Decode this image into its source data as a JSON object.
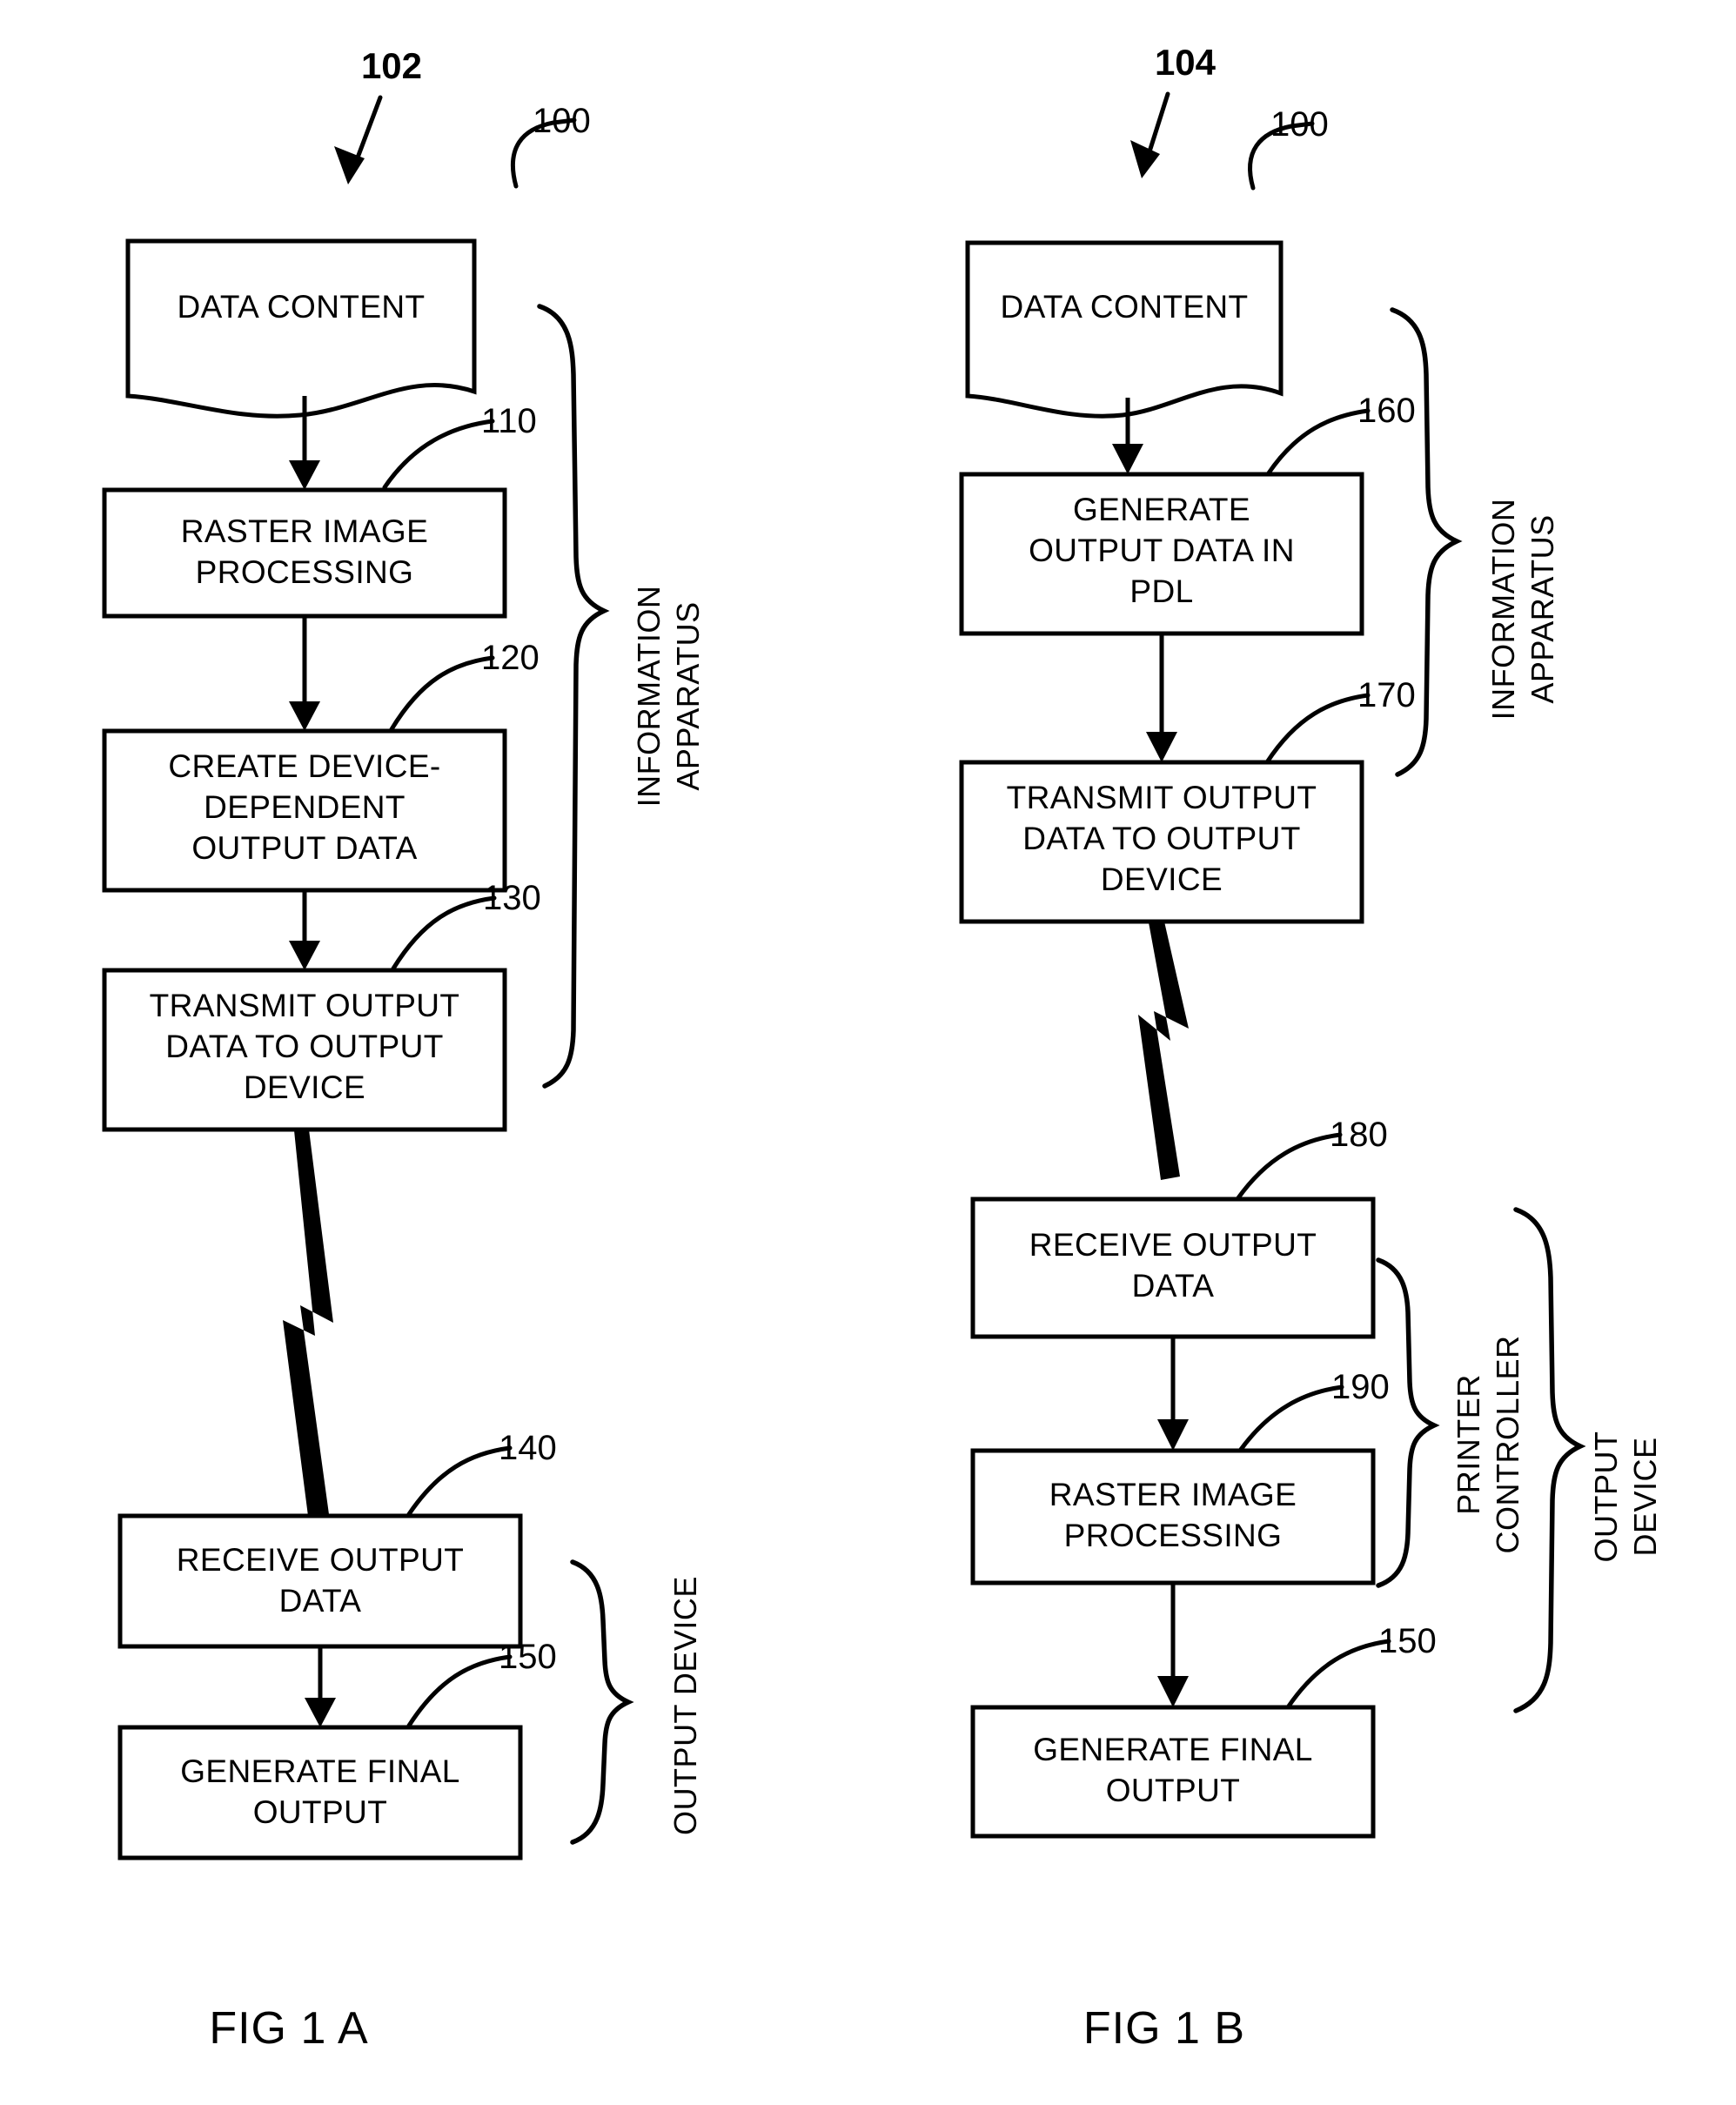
{
  "figure": {
    "page_title": "Patent Drawing - Output Data Flow",
    "captions": {
      "fig_a": "FIG 1 A",
      "fig_b": "FIG 1 B"
    }
  },
  "fig_a": {
    "diagram_ref": "102",
    "boxes": [
      {
        "id": "data-content",
        "ref": "100",
        "lines": [
          "DATA CONTENT"
        ],
        "shape": "document"
      },
      {
        "id": "raster-image",
        "ref": "110",
        "lines": [
          "RASTER IMAGE",
          "PROCESSING"
        ],
        "shape": "rect"
      },
      {
        "id": "create-device",
        "ref": "120",
        "lines": [
          "CREATE DEVICE-",
          "DEPENDENT",
          "OUTPUT DATA"
        ],
        "shape": "rect"
      },
      {
        "id": "transmit",
        "ref": "130",
        "lines": [
          "TRANSMIT OUTPUT",
          "DATA TO OUTPUT",
          "DEVICE"
        ],
        "shape": "rect"
      },
      {
        "id": "receive",
        "ref": "140",
        "lines": [
          "RECEIVE OUTPUT",
          "DATA"
        ],
        "shape": "rect"
      },
      {
        "id": "generate-final",
        "ref": "150",
        "lines": [
          "GENERATE FINAL",
          "OUTPUT"
        ],
        "shape": "rect"
      }
    ],
    "groups": [
      {
        "id": "information-apparatus",
        "lines": [
          "INFORMATION",
          "APPARATUS"
        ]
      },
      {
        "id": "output-device",
        "lines": [
          "OUTPUT DEVICE"
        ]
      }
    ]
  },
  "fig_b": {
    "diagram_ref": "104",
    "boxes": [
      {
        "id": "data-content",
        "ref": "100",
        "lines": [
          "DATA CONTENT"
        ],
        "shape": "document"
      },
      {
        "id": "generate-pdl",
        "ref": "160",
        "lines": [
          "GENERATE",
          "OUTPUT DATA IN",
          "PDL"
        ],
        "shape": "rect"
      },
      {
        "id": "transmit",
        "ref": "170",
        "lines": [
          "TRANSMIT OUTPUT",
          "DATA TO OUTPUT",
          "DEVICE"
        ],
        "shape": "rect"
      },
      {
        "id": "receive",
        "ref": "180",
        "lines": [
          "RECEIVE OUTPUT",
          "DATA"
        ],
        "shape": "rect"
      },
      {
        "id": "raster-image",
        "ref": "190",
        "lines": [
          "RASTER IMAGE",
          "PROCESSING"
        ],
        "shape": "rect"
      },
      {
        "id": "generate-final",
        "ref": "150",
        "lines": [
          "GENERATE FINAL",
          "OUTPUT"
        ],
        "shape": "rect"
      }
    ],
    "groups": [
      {
        "id": "information-apparatus",
        "lines": [
          "INFORMATION",
          "APPARATUS"
        ]
      },
      {
        "id": "printer-controller",
        "lines": [
          "PRINTER",
          "CONTROLLER"
        ]
      },
      {
        "id": "output-device",
        "lines": [
          "OUTPUT",
          "DEVICE"
        ]
      }
    ]
  },
  "text": {
    "a_100": "100",
    "a_102": "102",
    "a_110": "110",
    "a_120": "120",
    "a_130": "130",
    "a_140": "140",
    "a_150": "150",
    "b_100": "100",
    "b_104": "104",
    "b_150": "150",
    "b_160": "160",
    "b_170": "170",
    "b_180": "180",
    "b_190": "190",
    "a_data_content": "DATA CONTENT",
    "a_raster_1": "RASTER IMAGE",
    "a_raster_2": "PROCESSING",
    "a_create_1": "CREATE DEVICE-",
    "a_create_2": "DEPENDENT",
    "a_create_3": "OUTPUT DATA",
    "a_transmit_1": "TRANSMIT OUTPUT",
    "a_transmit_2": "DATA TO OUTPUT",
    "a_transmit_3": "DEVICE",
    "a_receive_1": "RECEIVE OUTPUT",
    "a_receive_2": "DATA",
    "a_final_1": "GENERATE FINAL",
    "a_final_2": "OUTPUT",
    "a_grp_info_1": "INFORMATION",
    "a_grp_info_2": "APPARATUS",
    "a_grp_outdev": "OUTPUT DEVICE",
    "b_data_content": "DATA CONTENT",
    "b_gen_1": "GENERATE",
    "b_gen_2": "OUTPUT DATA IN",
    "b_gen_3": "PDL",
    "b_transmit_1": "TRANSMIT OUTPUT",
    "b_transmit_2": "DATA TO OUTPUT",
    "b_transmit_3": "DEVICE",
    "b_receive_1": "RECEIVE OUTPUT",
    "b_receive_2": "DATA",
    "b_raster_1": "RASTER IMAGE",
    "b_raster_2": "PROCESSING",
    "b_final_1": "GENERATE FINAL",
    "b_final_2": "OUTPUT",
    "b_grp_info_1": "INFORMATION",
    "b_grp_info_2": "APPARATUS",
    "b_grp_pc_1": "PRINTER",
    "b_grp_pc_2": "CONTROLLER",
    "b_grp_od_1": "OUTPUT",
    "b_grp_od_2": "DEVICE",
    "cap_a": "FIG 1 A",
    "cap_b": "FIG 1 B"
  },
  "colors": {
    "ink": "#000000",
    "paper": "#ffffff"
  }
}
